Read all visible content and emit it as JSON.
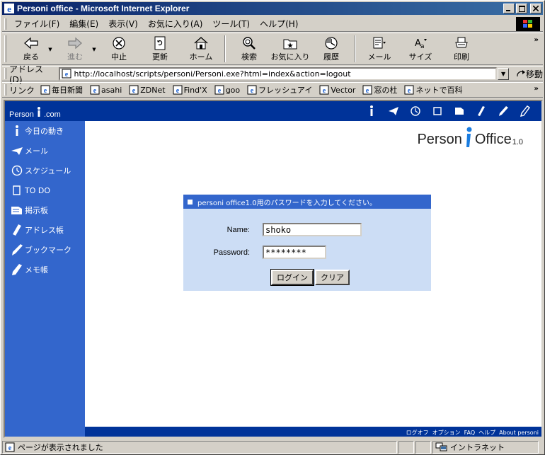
{
  "window": {
    "title": "Personi office - Microsoft Internet Explorer"
  },
  "menu": [
    "ファイル(F)",
    "編集(E)",
    "表示(V)",
    "お気に入り(A)",
    "ツール(T)",
    "ヘルプ(H)"
  ],
  "toolbar": {
    "back": "戻る",
    "forward": "進む",
    "stop": "中止",
    "refresh": "更新",
    "home": "ホーム",
    "search": "検索",
    "favorites": "お気に入り",
    "history": "履歴",
    "mail": "メール",
    "size": "サイズ",
    "print": "印刷",
    "more": "»"
  },
  "address": {
    "label": "アドレス(D)",
    "url": "http://localhost/scripts/personi/Personi.exe?html=index&action=logout",
    "go": "移動"
  },
  "links": {
    "label": "リンク",
    "items": [
      "毎日新聞",
      "asahi",
      "ZDNet",
      "Find'X",
      "goo",
      "フレッシュアイ",
      "Vector",
      "窓の杜",
      "ネットで百科"
    ],
    "more": "»"
  },
  "page": {
    "brand_prefix": "Person",
    "brand_suffix": ".com",
    "sidebar": [
      "今日の動き",
      "メール",
      "スケジュール",
      "TO DO",
      "掲示板",
      "アドレス帳",
      "ブックマーク",
      "メモ帳"
    ],
    "logo": {
      "left": "Person",
      "right": "Office",
      "version": "1.0"
    },
    "login": {
      "header": "personi office1.0用のパスワードを入力してください。",
      "name_label": "Name:",
      "name_value": "shoko",
      "password_label": "Password:",
      "password_value": "********",
      "login_button": "ログイン",
      "clear_button": "クリア"
    },
    "footer_links": [
      "ログオフ",
      "オプション",
      "FAQ",
      "ヘルプ",
      "About personi"
    ]
  },
  "status": {
    "text": "ページが表示されました",
    "zone": "イントラネット"
  },
  "colors": {
    "nav_dark": "#003399",
    "sidebar": "#3366cc",
    "login_bg": "#ccddf5"
  }
}
